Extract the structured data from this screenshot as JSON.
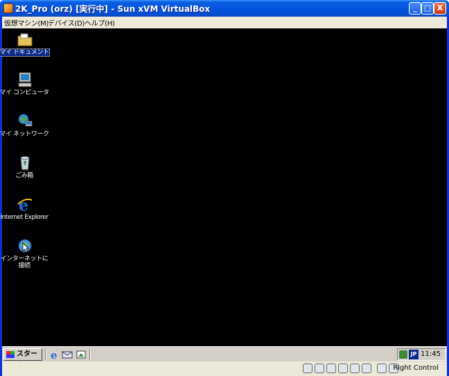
{
  "window": {
    "title": "2K_Pro (orz) [実行中] - Sun xVM VirtualBox",
    "minimize_glyph": "_",
    "maximize_glyph": "□",
    "close_glyph": "X"
  },
  "menu": [
    {
      "label": "仮想マシン(M)"
    },
    {
      "label": "デバイス(D)"
    },
    {
      "label": "ヘルプ(H)"
    }
  ],
  "desktop": {
    "icons": [
      {
        "label": "マイ ドキュメント",
        "icon": "folder-icon"
      },
      {
        "label": "マイ コンピュータ",
        "icon": "computer-icon"
      },
      {
        "label": "マイ ネットワーク",
        "icon": "network-icon"
      },
      {
        "label": "ごみ箱",
        "icon": "recycle-bin-icon"
      },
      {
        "label": "Internet Explorer",
        "icon": "ie-icon"
      },
      {
        "label": "インターネットに接続",
        "icon": "connect-icon"
      }
    ]
  },
  "taskbar": {
    "start_label": "スタート",
    "ime": "JP",
    "clock": "11:45"
  },
  "statusbar": {
    "host_key": "Right Control"
  }
}
